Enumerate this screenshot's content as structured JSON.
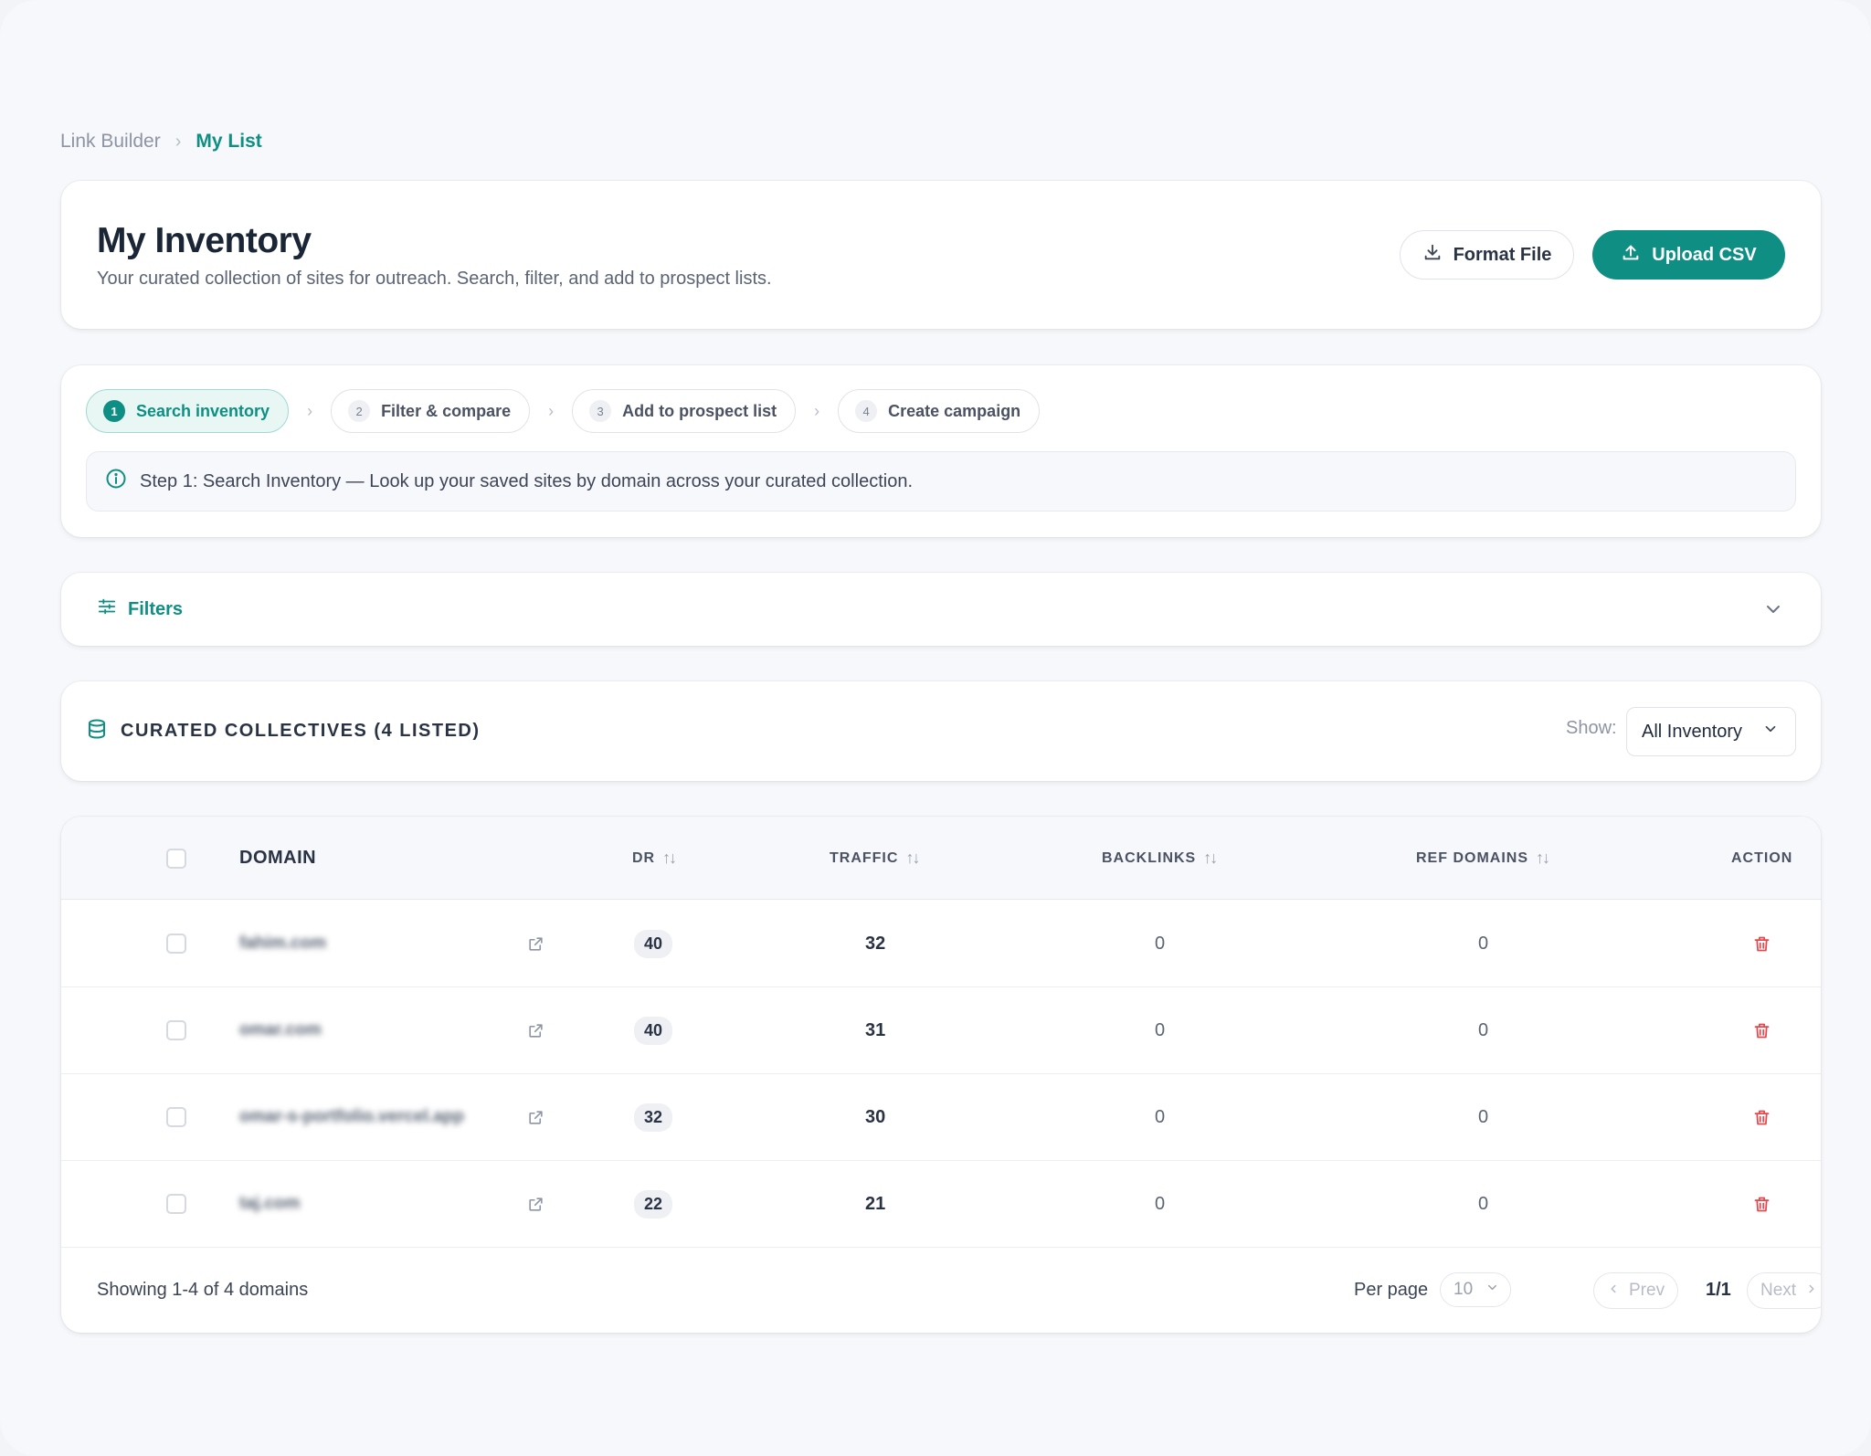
{
  "breadcrumb": {
    "root": "Link Builder",
    "current": "My List"
  },
  "header": {
    "title": "My Inventory",
    "subtitle": "Your curated collection of sites for outreach. Search, filter, and add to prospect lists.",
    "format_file_label": "Format File",
    "upload_csv_label": "Upload CSV"
  },
  "steps": {
    "items": [
      {
        "number": "1",
        "label": "Search inventory",
        "active": true
      },
      {
        "number": "2",
        "label": "Filter & compare",
        "active": false
      },
      {
        "number": "3",
        "label": "Add to prospect list",
        "active": false
      },
      {
        "number": "4",
        "label": "Create campaign",
        "active": false
      }
    ],
    "info_text": "Step 1: Search Inventory — Look up your saved sites by domain across your curated collection."
  },
  "filters": {
    "label": "Filters"
  },
  "collection": {
    "title": "CURATED COLLECTIVES (4 LISTED)",
    "show_label": "Show:",
    "show_value": "All Inventory"
  },
  "table": {
    "columns": {
      "domain": "DOMAIN",
      "dr": "DR",
      "traffic": "TRAFFIC",
      "backlinks": "BACKLINKS",
      "ref_domains": "REF DOMAINS",
      "action": "ACTION"
    },
    "rows": [
      {
        "domain": "fahim.com",
        "dr": "40",
        "traffic": "32",
        "backlinks": "0",
        "ref_domains": "0"
      },
      {
        "domain": "omar.com",
        "dr": "40",
        "traffic": "31",
        "backlinks": "0",
        "ref_domains": "0"
      },
      {
        "domain": "omar-s-portfolio.vercel.app",
        "dr": "32",
        "traffic": "30",
        "backlinks": "0",
        "ref_domains": "0"
      },
      {
        "domain": "taj.com",
        "dr": "22",
        "traffic": "21",
        "backlinks": "0",
        "ref_domains": "0"
      }
    ]
  },
  "pagination": {
    "showing_text": "Showing 1-4 of 4 domains",
    "per_page_label": "Per page",
    "per_page_value": "10",
    "prev_label": "Prev",
    "page_indicator": "1/1",
    "next_label": "Next"
  },
  "colors": {
    "accent": "#0f8e83",
    "danger": "#e5484d",
    "page_bg": "#f7f8fb"
  }
}
